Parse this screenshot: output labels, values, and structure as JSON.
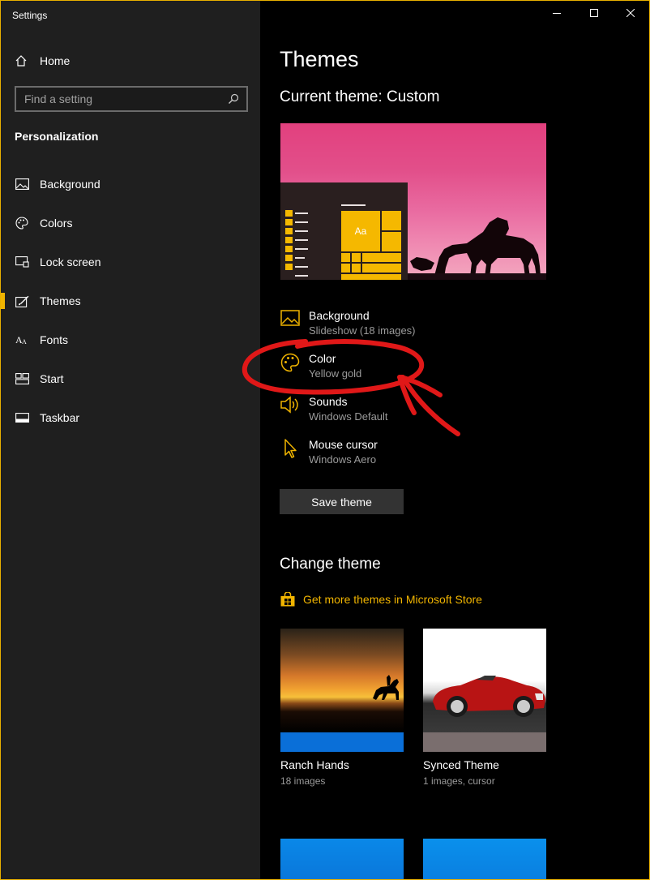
{
  "window": {
    "title": "Settings",
    "accent_color": "#f0b400"
  },
  "sidebar": {
    "home_label": "Home",
    "search_placeholder": "Find a setting",
    "section_label": "Personalization",
    "items": [
      {
        "label": "Background",
        "icon": "image-icon",
        "active": false
      },
      {
        "label": "Colors",
        "icon": "palette-icon",
        "active": false
      },
      {
        "label": "Lock screen",
        "icon": "lock-screen-icon",
        "active": false
      },
      {
        "label": "Themes",
        "icon": "brush-icon",
        "active": true
      },
      {
        "label": "Fonts",
        "icon": "fonts-icon",
        "active": false
      },
      {
        "label": "Start",
        "icon": "start-icon",
        "active": false
      },
      {
        "label": "Taskbar",
        "icon": "taskbar-icon",
        "active": false
      }
    ]
  },
  "main": {
    "title": "Themes",
    "current_theme": "Current theme: Custom",
    "preview_tile_text": "Aa",
    "settings": [
      {
        "title": "Background",
        "subtitle": "Slideshow (18 images)",
        "icon": "image-icon"
      },
      {
        "title": "Color",
        "subtitle": "Yellow gold",
        "icon": "palette-icon"
      },
      {
        "title": "Sounds",
        "subtitle": "Windows Default",
        "icon": "speaker-icon"
      },
      {
        "title": "Mouse cursor",
        "subtitle": "Windows Aero",
        "icon": "cursor-icon"
      }
    ],
    "save_button": "Save theme",
    "change_title": "Change theme",
    "store_link": "Get more themes in Microsoft Store",
    "themes": [
      {
        "name": "Ranch Hands",
        "sub": "18 images",
        "bar_color": "#0a6fd8"
      },
      {
        "name": "Synced Theme",
        "sub": "1 images, cursor",
        "bar_color": "#7a6e6e"
      }
    ]
  }
}
